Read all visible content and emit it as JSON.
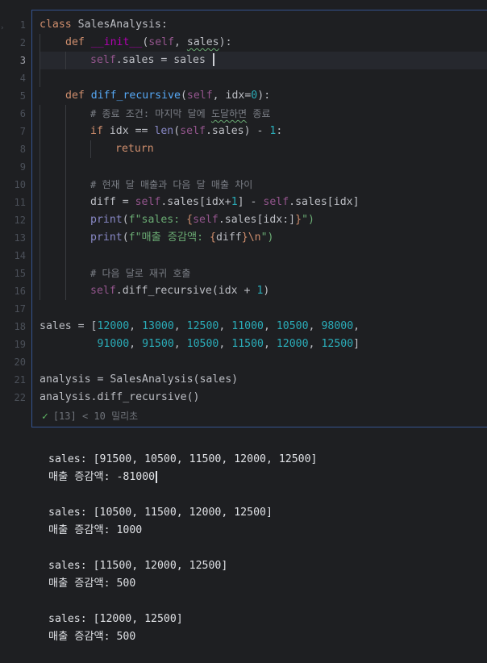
{
  "editor": {
    "active_line": 3,
    "line_numbers": [
      "1",
      "2",
      "3",
      "4",
      "5",
      "6",
      "7",
      "8",
      "9",
      "10",
      "11",
      "12",
      "13",
      "14",
      "15",
      "16",
      "17",
      "18",
      "19",
      "20",
      "21",
      "22"
    ],
    "lines": {
      "l1": [
        "class",
        " SalesAnalysis:"
      ],
      "l2": [
        "def",
        " ",
        "__init__",
        "(",
        "self",
        ", ",
        "sales",
        "):"
      ],
      "l3": [
        "self",
        ".sales = sales "
      ],
      "l5": [
        "def",
        " ",
        "diff_recursive",
        "(",
        "self",
        ", idx=",
        "0",
        "):"
      ],
      "l6": [
        "# 종료 조건: 마지막 달에 ",
        "도달하면",
        " 종료"
      ],
      "l7": [
        "if",
        " idx == ",
        "len",
        "(",
        "self",
        ".sales) - ",
        "1",
        ":"
      ],
      "l8": [
        "return"
      ],
      "l10": [
        "# 현재 달 매출과 다음 달 매출 차이"
      ],
      "l11": [
        "diff = ",
        "self",
        ".sales[idx+",
        "1",
        "] - ",
        "self",
        ".sales[idx]"
      ],
      "l12": [
        "print",
        "(",
        "f\"sales: ",
        "{",
        "self",
        ".sales[idx:]",
        "}",
        "\")"
      ],
      "l13": [
        "print",
        "(",
        "f\"매출 증감액: ",
        "{",
        "diff",
        "}",
        "\\n",
        "\")"
      ],
      "l15": [
        "# 다음 달로 재귀 호출"
      ],
      "l16": [
        "self",
        ".diff_recursive(idx + ",
        "1",
        ")"
      ],
      "l18": [
        "sales = [",
        "12000",
        ", ",
        "13000",
        ", ",
        "12500",
        ", ",
        "11000",
        ", ",
        "10500",
        ", ",
        "98000",
        ","
      ],
      "l19": [
        "         ",
        "91000",
        ", ",
        "91500",
        ", ",
        "10500",
        ", ",
        "11500",
        ", ",
        "12000",
        ", ",
        "12500",
        "]"
      ],
      "l21": [
        "analysis = SalesAnalysis(sales)"
      ],
      "l22": [
        "analysis.diff_recursive()"
      ]
    },
    "exec_status": "[13] < 10 밀리초",
    "check_icon": "✓"
  },
  "output": [
    "sales: [91500, 10500, 11500, 12000, 12500]",
    "매출 증감액: -81000",
    "sales: [10500, 11500, 12000, 12500]",
    "매출 증감액: 1000",
    "sales: [11500, 12000, 12500]",
    "매출 증감액: 500",
    "sales: [12000, 12500]",
    "매출 증감액: 500"
  ],
  "colors": {
    "background": "#1e1f22",
    "keyword": "#cf8e6d",
    "function": "#56a8f5",
    "self": "#94558d",
    "number": "#2aacb8",
    "string": "#6aab73",
    "comment": "#7a7e85",
    "cell_border": "#35538f"
  }
}
